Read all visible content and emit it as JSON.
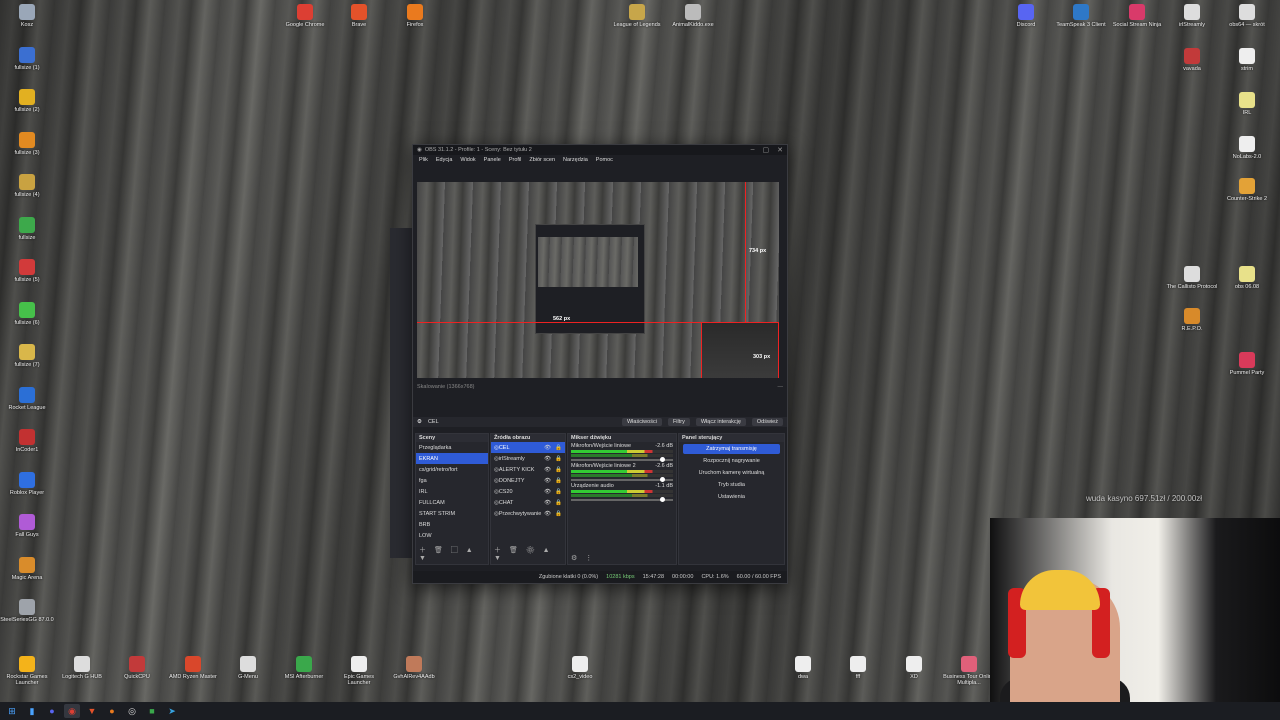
{
  "desktop": {
    "left_column": [
      {
        "label": "Kosz",
        "icon": "recycle-bin-icon",
        "color": "#9aa7b8"
      },
      {
        "label": "fullsize (1)",
        "icon": "app-icon",
        "color": "#3b6fd1"
      },
      {
        "label": "fullsize (2)",
        "icon": "app-icon",
        "color": "#e2b021"
      },
      {
        "label": "fullsize (3)",
        "icon": "app-icon",
        "color": "#e28a21"
      },
      {
        "label": "fullsize (4)",
        "icon": "app-icon",
        "color": "#c9a241"
      },
      {
        "label": "fullsize",
        "icon": "app-icon",
        "color": "#3da94b"
      },
      {
        "label": "fullsize (5)",
        "icon": "app-icon",
        "color": "#d23a3a"
      },
      {
        "label": "fullsize (6)",
        "icon": "app-icon",
        "color": "#46c04a"
      },
      {
        "label": "fullsize (7)",
        "icon": "app-icon",
        "color": "#d9b74a"
      },
      {
        "label": "Rocket League",
        "icon": "rocket-league-icon",
        "color": "#2b6fd6"
      },
      {
        "label": "InCoder1",
        "icon": "app-icon",
        "color": "#c23131"
      },
      {
        "label": "Roblox Player",
        "icon": "roblox-icon",
        "color": "#2f6fe0"
      },
      {
        "label": "Fall Guys",
        "icon": "fall-guys-icon",
        "color": "#b05bd6"
      },
      {
        "label": "Magic Arena",
        "icon": "magic-arena-icon",
        "color": "#d98c2b"
      },
      {
        "label": "SteelSeriesGG 87.0.0",
        "icon": "steelseries-icon",
        "color": "#9ea3aa"
      }
    ],
    "top_row": [
      {
        "label": "Google Chrome",
        "icon": "chrome-icon",
        "color": "#dc3f33"
      },
      {
        "label": "Brave",
        "icon": "brave-icon",
        "color": "#e4522a"
      },
      {
        "label": "Firefox",
        "icon": "firefox-icon",
        "color": "#ea7a1e"
      },
      {
        "label": "League of Legends",
        "icon": "league-icon",
        "color": "#c7a64a"
      },
      {
        "label": "AnimalKiddo.exe",
        "icon": "app-icon",
        "color": "#bbbbbb"
      }
    ],
    "right_top_row": [
      {
        "label": "Discord",
        "icon": "discord-icon",
        "color": "#5865f2"
      },
      {
        "label": "TeamSpeak 3 Client",
        "icon": "teamspeak-icon",
        "color": "#2e78c7"
      },
      {
        "label": "Social Stream Ninja",
        "icon": "ninja-icon",
        "color": "#d93a6a"
      },
      {
        "label": "irlStreamly",
        "icon": "app-icon",
        "color": "#dddddd"
      },
      {
        "label": "obs64 — skrót",
        "icon": "obs-icon",
        "color": "#dddddd"
      }
    ],
    "right_misc": [
      {
        "label": "vavada",
        "icon": "app-icon",
        "color": "#c23a3a"
      },
      {
        "label": "strim",
        "icon": "file-icon",
        "color": "#eeeeee"
      },
      {
        "label": "IRL",
        "icon": "file-icon",
        "color": "#e8e18a"
      },
      {
        "label": "NoLabs-2.0",
        "icon": "file-icon",
        "color": "#eeeeee"
      },
      {
        "label": "Counter-Strike 2",
        "icon": "cs2-icon",
        "color": "#e3a237"
      },
      {
        "label": "The Callisto Protocol",
        "icon": "callisto-icon",
        "color": "#dddddd"
      },
      {
        "label": "obs 06.08",
        "icon": "file-icon",
        "color": "#e8e18a"
      },
      {
        "label": "R.E.P.O.",
        "icon": "repo-icon",
        "color": "#d88a2a"
      },
      {
        "label": "Pummel Party",
        "icon": "pummel-party-icon",
        "color": "#d93a5a"
      }
    ],
    "bottom_row": [
      {
        "label": "Rockstar Games Launcher",
        "icon": "rockstar-icon",
        "color": "#f4b31a"
      },
      {
        "label": "Logitech G HUB",
        "icon": "logitech-icon",
        "color": "#dddddd"
      },
      {
        "label": "QuickCPU",
        "icon": "quickcpu-icon",
        "color": "#c23a3a"
      },
      {
        "label": "AMD Ryzen Master",
        "icon": "amd-icon",
        "color": "#d9472b"
      },
      {
        "label": "G-Menu",
        "icon": "gmenu-icon",
        "color": "#dddddd"
      },
      {
        "label": "MSI Afterburner",
        "icon": "msi-icon",
        "color": "#3aa84b"
      },
      {
        "label": "Epic Games Launcher",
        "icon": "epic-icon",
        "color": "#eeeeee"
      },
      {
        "label": "GvhAlRev4AAdb",
        "icon": "app-icon",
        "color": "#c07a5a"
      },
      {
        "label": "cs2_video",
        "icon": "file-icon",
        "color": "#eeeeee"
      },
      {
        "label": "dwa",
        "icon": "file-icon",
        "color": "#eeeeee"
      },
      {
        "label": "fff",
        "icon": "file-icon",
        "color": "#eeeeee"
      },
      {
        "label": "XD",
        "icon": "file-icon",
        "color": "#eeeeee"
      },
      {
        "label": "Business Tour Online Multipla...",
        "icon": "business-tour-icon",
        "color": "#e0607a"
      }
    ]
  },
  "obs": {
    "title": "OBS 31.1.2 - Profile: 1 - Sceny: Bez tytułu 2",
    "menu": [
      "Plik",
      "Edycja",
      "Widok",
      "Panele",
      "Profil",
      "Zbiór scen",
      "Narzędzia",
      "Pomoc"
    ],
    "preview": {
      "label_top": "734 px",
      "label_mid": "562 px",
      "label_cam": "303 px"
    },
    "status_left": "Skalowanie (1366x768)",
    "status_right": "—",
    "selected_source": "CEL",
    "toolbar": {
      "properties": "Właściwości",
      "filters": "Filtry",
      "interact": "Włącz interakcję",
      "refresh": "Odśwież"
    },
    "scenes": {
      "title": "Sceny",
      "items": [
        "Przeglądarka",
        "EKRAN",
        "cs/grid/retro/fort",
        "fga",
        "IRL",
        "FULLCAM",
        "START STRIM",
        "BRB",
        "LOW"
      ],
      "selected_index": 1
    },
    "sources": {
      "title": "Źródła obrazu",
      "items": [
        "CEL",
        "irlStreamly",
        "ALERTY KICK",
        "DONEJTY",
        "CS20",
        "CHAT",
        "Przechwytywanie"
      ],
      "selected_index": 0
    },
    "mixer": {
      "title": "Mikser dźwięku",
      "channels": [
        {
          "name": "Mikrofon/Wejście liniowe",
          "db": "-2.6 dB"
        },
        {
          "name": "Mikrofon/Wejście liniowe 2",
          "db": "-2.6 dB"
        },
        {
          "name": "Urządzenie audio",
          "db": "-1.1 dB"
        }
      ]
    },
    "controls": {
      "title": "Panel sterujący",
      "stop_stream": "Zatrzymaj transmisję",
      "record": "Rozpocznij nagrywanie",
      "virtual_cam": "Uruchom kamerę wirtualną",
      "studio": "Tryb studia",
      "settings": "Ustawienia"
    },
    "statusbar": {
      "dropped": "Zgubione klatki 0 (0.0%)",
      "kbps": "10281 kbps",
      "live_time": "15:47:28",
      "rec_time": "00:00:00",
      "cpu": "CPU: 1.6%",
      "fps": "60.00 / 60.00 FPS"
    }
  },
  "overlay": {
    "donation_goal": "wuda kasyno 697.51zł / 200.00zł"
  },
  "colors": {
    "obs_accent": "#2f5bd6",
    "guide_red": "#e22222"
  }
}
